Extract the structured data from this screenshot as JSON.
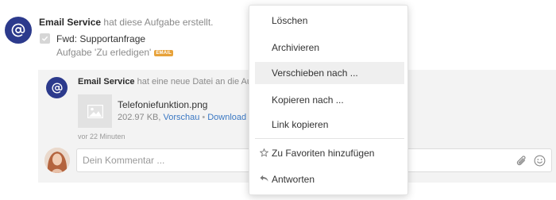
{
  "activity": {
    "author": "Email Service",
    "action": "hat diese Aufgabe erstellt.",
    "task_title": "Fwd: Supportanfrage",
    "task_status": "Aufgabe 'Zu erledigen'",
    "task_badge": "EMAIL"
  },
  "file_post": {
    "author": "Email Service",
    "action": "hat eine neue Datei an die Au",
    "file_name": "Telefoniefunktion.png",
    "file_size": "202.97 KB,",
    "preview_link": "Vorschau",
    "download_link": "Download",
    "time": "vor 22 Minuten"
  },
  "comment": {
    "placeholder": "Dein Kommentar ..."
  },
  "context_menu": {
    "items": [
      {
        "label": "Löschen"
      },
      {
        "label": "Archivieren"
      },
      {
        "label": "Verschieben nach ..."
      },
      {
        "label": "Kopieren nach ..."
      },
      {
        "label": "Link kopieren"
      },
      {
        "label": "Zu Favoriten hinzufügen",
        "icon": "star-outline-icon"
      },
      {
        "label": "Antworten",
        "icon": "reply-arrow-icon"
      }
    ],
    "highlighted_index": 2
  },
  "colors": {
    "avatar": "#2c3a8c",
    "badge": "#e7a23a",
    "link": "#3b78c3",
    "panel_bg": "#f3f3f3"
  }
}
